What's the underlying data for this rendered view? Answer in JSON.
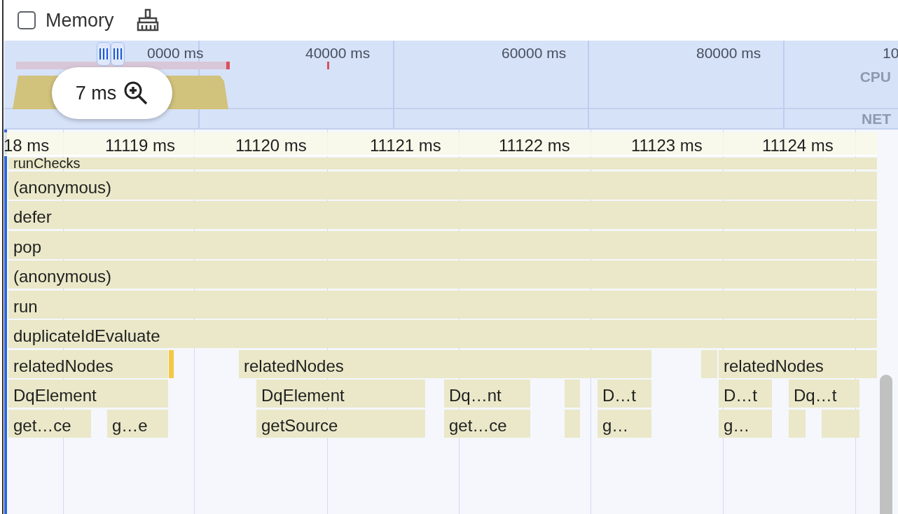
{
  "toolbar": {
    "memory": {
      "label": "Memory",
      "checked": false
    }
  },
  "overview": {
    "ticks": [
      "0000 ms",
      "40000 ms",
      "60000 ms",
      "80000 ms",
      "10"
    ],
    "tracks": [
      "CPU",
      "NET"
    ],
    "zoom_label": "7 ms"
  },
  "ruler": {
    "ticks": [
      "18 ms",
      "11119 ms",
      "11120 ms",
      "11121 ms",
      "11122 ms",
      "11123 ms",
      "11124 ms"
    ]
  },
  "flame_rows": [
    {
      "blocks": [
        {
          "label": "runChecks"
        }
      ]
    },
    {
      "blocks": [
        {
          "label": "(anonymous)"
        }
      ]
    },
    {
      "blocks": [
        {
          "label": "defer"
        }
      ]
    },
    {
      "blocks": [
        {
          "label": "pop"
        }
      ]
    },
    {
      "blocks": [
        {
          "label": "(anonymous)"
        }
      ]
    },
    {
      "blocks": [
        {
          "label": "run"
        }
      ]
    },
    {
      "blocks": [
        {
          "label": "duplicateIdEvaluate"
        }
      ]
    },
    {
      "blocks": [
        {
          "label": "relatedNodes"
        },
        {
          "kind": "mark"
        },
        {
          "label": "relatedNodes"
        },
        {
          "kind": "blank"
        },
        {
          "label": "relatedNodes"
        }
      ]
    },
    {
      "blocks": [
        {
          "label": "DqElement"
        },
        {
          "label": "DqElement"
        },
        {
          "label": "Dq…nt"
        },
        {
          "kind": "blank"
        },
        {
          "label": "D…t"
        },
        {
          "label": "D…t"
        },
        {
          "label": "Dq…t"
        }
      ]
    },
    {
      "blocks": [
        {
          "label": "get…ce"
        },
        {
          "label": "g…e"
        },
        {
          "label": "getSource"
        },
        {
          "label": "get…ce"
        },
        {
          "kind": "blank"
        },
        {
          "label": "g…"
        },
        {
          "label": "g…"
        },
        {
          "kind": "blank"
        },
        {
          "kind": "blank"
        }
      ]
    }
  ]
}
